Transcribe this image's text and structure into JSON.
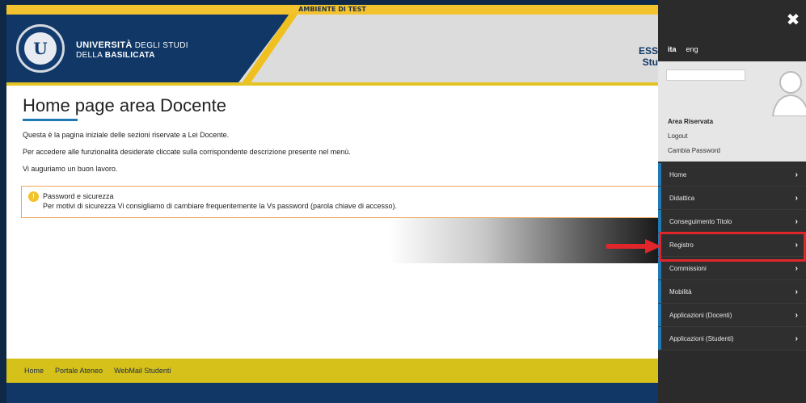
{
  "header": {
    "test_banner": "AMBIENTE DI TEST",
    "uni_line1_bold": "UNIVERSITÀ",
    "uni_line1_rest": " DEGLI STUDI",
    "uni_line2_pre": "DELLA ",
    "uni_line2_bold": "BASILICATA",
    "right_line1": "ESS",
    "right_line2": "Stu"
  },
  "main": {
    "title": "Home page area Docente",
    "paragraphs": [
      "Questa è la pagina iniziale delle sezioni riservate a Lei Docente.",
      "Per accedere alle funzionalità desiderate cliccate sulla corrispondente descrizione presente nel menù.",
      "Vi auguriamo un buon lavoro."
    ],
    "alert": {
      "icon": "!",
      "title": "Password e sicurezza",
      "text": "Per motivi di sicurezza Vi consigliamo di cambiare frequentemente la Vs password (parola chiave di accesso)."
    }
  },
  "footer": {
    "links": [
      "Home",
      "Portale Ateneo",
      "WebMail Studenti"
    ]
  },
  "drawer": {
    "close_icon": "✖",
    "languages": [
      "ita",
      "eng"
    ],
    "active_language": "ita",
    "area_riservata": "Area Riservata",
    "logout": "Logout",
    "cambia_password": "Cambia Password",
    "menu": [
      {
        "label": "Home"
      },
      {
        "label": "Didattica"
      },
      {
        "label": "Conseguimento Titolo"
      },
      {
        "label": "Registro"
      },
      {
        "label": "Commissioni"
      },
      {
        "label": "Mobilità"
      },
      {
        "label": "Applicazioni (Docenti)"
      },
      {
        "label": "Applicazioni (Studenti)"
      }
    ],
    "chevron": "›"
  },
  "colors": {
    "brand_blue": "#103766",
    "brand_yellow": "#f0c020",
    "highlight_red": "#e0262a",
    "accent_blue": "#1f79b5"
  }
}
